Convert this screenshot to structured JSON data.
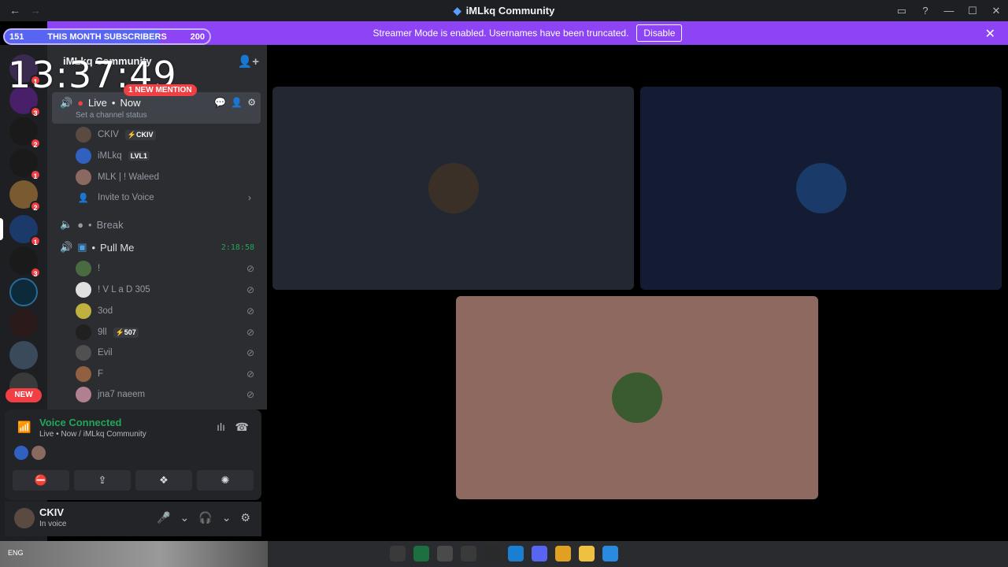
{
  "window": {
    "title": "iMLkq Community",
    "nav_back": "←",
    "nav_forward": "→",
    "controls": [
      "▭",
      "?",
      "—",
      "☐",
      "✕"
    ]
  },
  "streamer_banner": {
    "text": "Streamer Mode is enabled. Usernames have been truncated.",
    "button": "Disable",
    "close": "✕",
    "color": "#8c44f5"
  },
  "subscribers_bar": {
    "current": "151",
    "label": "THIS MONTH SUBSCRIBERS",
    "goal": "200",
    "progress": 0.755
  },
  "overlay_clock": "13:37:49",
  "mention_pill": "1 NEW MENTION",
  "server": {
    "name": "iMLkq Community"
  },
  "guilds": [
    {
      "badge": "1",
      "color": "#3b2a50"
    },
    {
      "badge": "3",
      "color": "#4a1f6a"
    },
    {
      "badge": "2",
      "color": "#1a1a1a"
    },
    {
      "badge": "1",
      "color": "#1a1a1a"
    },
    {
      "badge": "2",
      "color": "#7a5a30"
    },
    {
      "badge": "1",
      "color": "#1b3a6a"
    },
    {
      "badge": "3",
      "color": "#1a1a1a"
    },
    {
      "badge": "",
      "color": "#0c2a3a"
    },
    {
      "badge": "",
      "color": "#2a1a1a"
    },
    {
      "badge": "",
      "color": "#3a4a5a"
    }
  ],
  "new_label": "NEW",
  "channels": {
    "live": {
      "name": "Live",
      "sub": "Now",
      "status": "Set a channel status"
    },
    "live_users": [
      {
        "name": "CKIV",
        "tag": "⚡CKIV",
        "color": "#5a4a42"
      },
      {
        "name": "iMLkq",
        "tag": "LVL1",
        "color": "#3060c0"
      },
      {
        "name": "MLK | ! Waleed",
        "tag": "",
        "color": "#8a6a60"
      }
    ],
    "invite": "Invite to Voice",
    "break": {
      "name": "Break"
    },
    "pull_me": {
      "name": "Pull Me",
      "timer": "2:18:58"
    },
    "pull_users": [
      {
        "name": "!",
        "tag": "",
        "color": "#4a6a40"
      },
      {
        "name": "! V L a D 305",
        "tag": "",
        "color": "#e0e0e0"
      },
      {
        "name": "3od",
        "tag": "",
        "color": "#c0b040"
      },
      {
        "name": "9ll",
        "tag": "⚡507",
        "color": "#202020"
      },
      {
        "name": "Evil",
        "tag": "",
        "color": "#505050"
      },
      {
        "name": "F",
        "tag": "",
        "color": "#906040"
      },
      {
        "name": "jna7 naeem",
        "tag": "",
        "color": "#b08090"
      }
    ]
  },
  "voice_panel": {
    "title": "Voice Connected",
    "subtitle": "Live • Now / iMLkq Community",
    "buttons": [
      "⛔",
      "⇪",
      "❖",
      "✺"
    ]
  },
  "user_panel": {
    "name": "CKIV",
    "status": "In voice"
  },
  "stage": {
    "tiles": [
      {
        "bg": "#232731",
        "avatar": "#3a3028"
      },
      {
        "bg": "#141c33",
        "avatar": "#1a3a6a"
      },
      {
        "bg": "#8e695f",
        "avatar": "#3a5a30"
      }
    ]
  },
  "taskbar": {
    "tray": "ENG"
  }
}
